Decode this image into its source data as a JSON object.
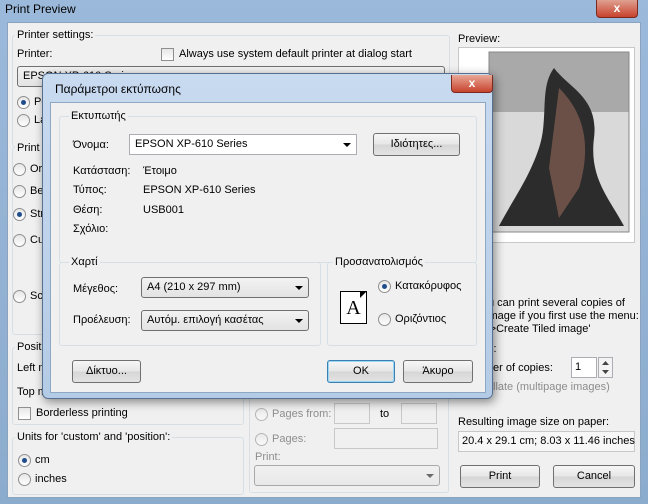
{
  "window": {
    "title": "Print Preview",
    "close_label": "x"
  },
  "printer_settings": {
    "group_label": "Printer settings:",
    "printer_label": "Printer:",
    "always_default_label": "Always use system default printer at dialog start",
    "printer_value": "EPSON XP-610 Series",
    "orientation_partial": [
      "Po",
      "La"
    ]
  },
  "print_size": {
    "label_partial": "Print s",
    "options_partial": [
      "Orig",
      "Bes",
      "Stre",
      "Cus",
      "Sca"
    ]
  },
  "position": {
    "label_partial": "Positio",
    "left_partial": "Left m",
    "top_partial": "Top m",
    "borderless_label": "Borderless printing"
  },
  "units": {
    "group_label": "Units for 'custom' and 'position':",
    "options": [
      "cm",
      "inches"
    ]
  },
  "pages": {
    "from_label": "Pages from:",
    "to_label": "to",
    "pages_label": "Pages:",
    "print_label": "Print:"
  },
  "preview": {
    "label": "Preview:",
    "tiled_text_lines": [
      "u can print several copies of",
      "image if you first use the menu:",
      "->Create Tiled image'"
    ],
    "copies_label_partial": "s:",
    "copies_label": "er of copies:",
    "copies_value": "1",
    "collate_label": "llate (multipage images)"
  },
  "result": {
    "label": "Resulting image size on paper:",
    "value": "20.4 x 29.1 cm; 8.03 x 11.46 inches"
  },
  "buttons": {
    "print": "Print",
    "cancel": "Cancel"
  },
  "dialog": {
    "title": "Παράμετροι εκτύπωσης",
    "close_label": "x",
    "printer_group": "Εκτυπωτής",
    "name_label": "Όνομα:",
    "name_value": "EPSON XP-610 Series",
    "properties_button": "Ιδιότητες...",
    "status_label": "Κατάσταση:",
    "status_value": "Έτοιμο",
    "type_label": "Τύπος:",
    "type_value": "EPSON XP-610 Series",
    "location_label": "Θέση:",
    "location_value": "USB001",
    "comment_label": "Σχόλιο:",
    "paper_group": "Χαρτί",
    "size_label": "Μέγεθος:",
    "size_value": "A4 (210 x 297 mm)",
    "source_label": "Προέλευση:",
    "source_value": "Αυτόμ. επιλογή κασέτας",
    "orientation_group": "Προσανατολισμός",
    "portrait_label": "Κατακόρυφος",
    "landscape_label": "Οριζόντιος",
    "orientation_icon_letter": "A",
    "network_button": "Δίκτυο...",
    "ok_button": "OK",
    "cancel_button": "Άκυρο"
  }
}
